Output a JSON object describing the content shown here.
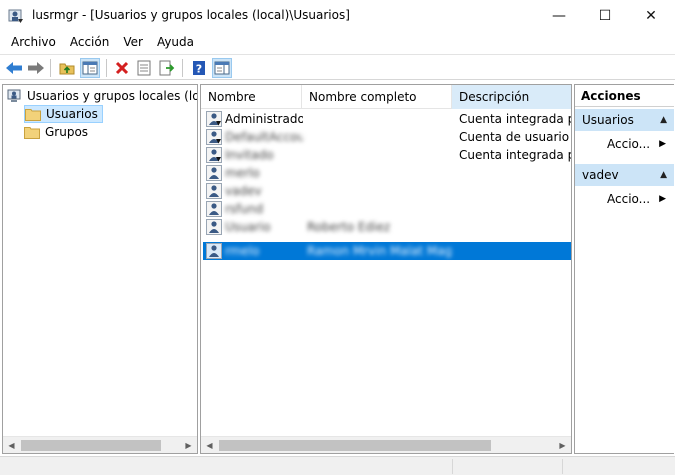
{
  "window": {
    "title": "lusrmgr - [Usuarios y grupos locales (local)\\Usuarios]",
    "minimize": "—",
    "maximize": "☐",
    "close": "✕"
  },
  "menu": {
    "items": [
      "Archivo",
      "Acción",
      "Ver",
      "Ayuda"
    ]
  },
  "toolbar": {
    "icons": [
      "back-arrow-icon",
      "forward-arrow-icon",
      "up-folder-icon",
      "show-hide-tree-icon",
      "delete-icon",
      "properties-icon",
      "export-list-icon",
      "help-icon",
      "show-action-pane-icon"
    ]
  },
  "tree": {
    "root": "Usuarios y grupos locales (local)",
    "nodes": [
      {
        "label": "Usuarios",
        "selected": true
      },
      {
        "label": "Grupos",
        "selected": false
      }
    ]
  },
  "list": {
    "columns": [
      "Nombre",
      "Nombre completo",
      "Descripción"
    ],
    "rows": [
      {
        "name": "Administrador",
        "full": "",
        "desc": "Cuenta integrada par",
        "blur": false,
        "selected": false
      },
      {
        "name": "DefaultAccount",
        "full": "",
        "desc": "Cuenta de usuario ad",
        "blur": true,
        "selected": false
      },
      {
        "name": "Invitado",
        "full": "",
        "desc": "Cuenta integrada par",
        "blur": true,
        "selected": false
      },
      {
        "name": "merlo",
        "full": "",
        "desc": "",
        "blur": true,
        "selected": false
      },
      {
        "name": "vadev",
        "full": "",
        "desc": "",
        "blur": true,
        "selected": false
      },
      {
        "name": "rsfund",
        "full": "",
        "desc": "",
        "blur": true,
        "selected": false
      },
      {
        "name": "Usuario",
        "full": "Roberto Ediez",
        "desc": "",
        "blur": true,
        "selected": false
      },
      {
        "name": "rmelo",
        "full": "Ramon Mrvin Malat Magual",
        "desc": "",
        "blur": true,
        "selected": true
      }
    ]
  },
  "actions": {
    "header": "Acciones",
    "sections": [
      {
        "title": "Usuarios",
        "item": "Accio..."
      },
      {
        "title": "vadev",
        "item": "Accio..."
      }
    ]
  },
  "colors": {
    "selection": "#0078d7",
    "tree_selection": "#cce8ff",
    "action_header": "#cce4f7"
  }
}
